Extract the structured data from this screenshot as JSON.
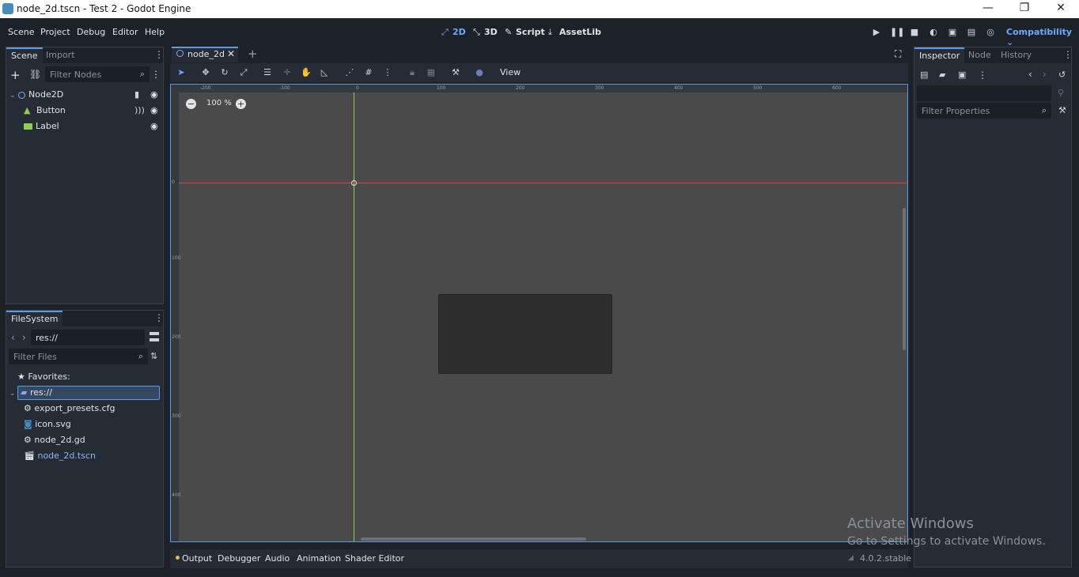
{
  "window": {
    "title": "node_2d.tscn - Test 2 - Godot Engine",
    "minimize": "—",
    "maximize": "❐",
    "close": "✕"
  },
  "menubar": {
    "items": [
      "Scene",
      "Project",
      "Debug",
      "Editor",
      "Help"
    ],
    "modes": [
      {
        "label": "2D",
        "icon": "2d-icon",
        "active": true
      },
      {
        "label": "3D",
        "icon": "3d-icon",
        "active": false
      },
      {
        "label": "Script",
        "icon": "script-icon",
        "active": false
      },
      {
        "label": "AssetLib",
        "icon": "assetlib-icon",
        "active": false
      }
    ],
    "renderer": "Compatibility"
  },
  "scene_dock": {
    "tabs": [
      "Scene",
      "Import"
    ],
    "filter_placeholder": "Filter Nodes",
    "nodes": [
      {
        "label": "Node2D",
        "icon": "node2d-icon"
      },
      {
        "label": "Button",
        "icon": "button-icon"
      },
      {
        "label": "Label",
        "icon": "label-icon"
      }
    ]
  },
  "filesystem_dock": {
    "tab": "FileSystem",
    "path": "res://",
    "filter_placeholder": "Filter Files",
    "favorites": "Favorites:",
    "root": "res://",
    "files": [
      {
        "label": "export_presets.cfg",
        "icon": "gear-icon"
      },
      {
        "label": "icon.svg",
        "icon": "image-icon"
      },
      {
        "label": "node_2d.gd",
        "icon": "gear-icon"
      },
      {
        "label": "node_2d.tscn",
        "icon": "scene-icon"
      }
    ]
  },
  "editor": {
    "scene_tab": "node_2d",
    "add_tab": "+",
    "view_menu": "View",
    "zoom": "100 %",
    "ruler_h": [
      "-200",
      "-100",
      "0",
      "100",
      "200",
      "300",
      "400",
      "500",
      "600"
    ],
    "ruler_v": [
      "0",
      "100",
      "200",
      "300",
      "400"
    ]
  },
  "bottom_panel": {
    "tabs": [
      "Output",
      "Debugger",
      "Audio",
      "Animation",
      "Shader Editor"
    ],
    "version": "4.0.2.stable"
  },
  "inspector_dock": {
    "tabs": [
      "Inspector",
      "Node",
      "History"
    ],
    "filter_placeholder": "Filter Properties"
  },
  "watermark": {
    "line1": "Activate Windows",
    "line2": "Go to Settings to activate Windows."
  },
  "colors": {
    "accent": "#5c9ce6",
    "x_axis": "#d2454f",
    "y_axis": "#8fd14f"
  }
}
